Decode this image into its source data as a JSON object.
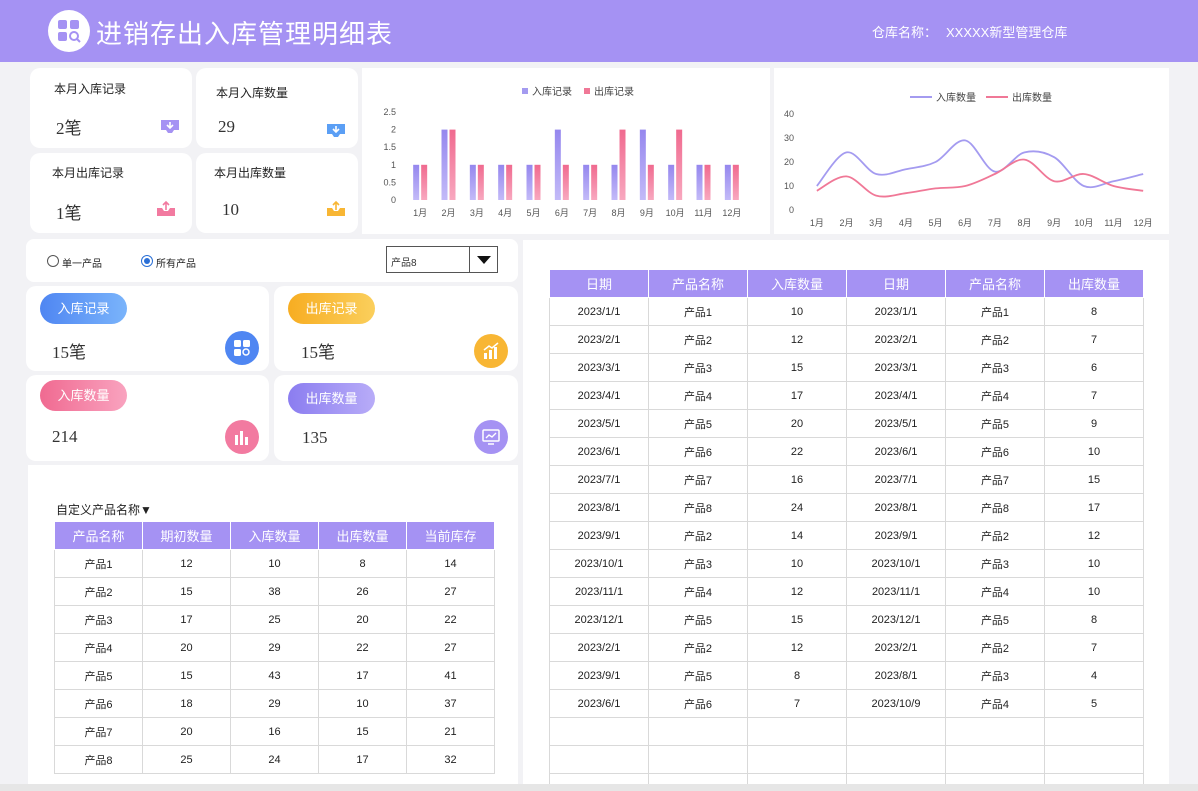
{
  "header": {
    "title": "进销存出入库管理明细表",
    "warehouse_label": "仓库名称：",
    "warehouse_value": "XXXXX新型管理仓库"
  },
  "kpis": [
    {
      "label": "本月入库记录",
      "value": "2笔",
      "icon": "inbox-in-icon"
    },
    {
      "label": "本月入库数量",
      "value": "29",
      "icon": "inbox-in-icon"
    },
    {
      "label": "本月出库记录",
      "value": "1笔",
      "icon": "outbox-icon"
    },
    {
      "label": "本月出库数量",
      "value": "10",
      "icon": "outbox-icon"
    }
  ],
  "filter": {
    "radio_single": "单一产品",
    "radio_all": "所有产品",
    "selected": "all",
    "dropdown_value": "产品8"
  },
  "stats": [
    {
      "label": "入库记录",
      "value": "15笔",
      "color": "#5b8ff5",
      "icon": "grid-search-icon"
    },
    {
      "label": "出库记录",
      "value": "15笔",
      "color": "#f8b634",
      "icon": "chart-growth-icon"
    },
    {
      "label": "入库数量",
      "value": "214",
      "color": "#f27aa0",
      "icon": "bar-chart-icon"
    },
    {
      "label": "出库数量",
      "value": "135",
      "color": "#a592f3",
      "icon": "monitor-icon"
    }
  ],
  "colors": {
    "accent": "#a592f3",
    "in": "#a49bf0",
    "out": "#f07897"
  },
  "chart_data": [
    {
      "type": "bar",
      "categories": [
        "1月",
        "2月",
        "3月",
        "4月",
        "5月",
        "6月",
        "7月",
        "8月",
        "9月",
        "10月",
        "11月",
        "12月"
      ],
      "series": [
        {
          "name": "入库记录",
          "values": [
            1,
            2,
            1,
            1,
            1,
            2,
            1,
            1,
            2,
            1,
            1,
            1
          ]
        },
        {
          "name": "出库记录",
          "values": [
            1,
            2,
            1,
            1,
            1,
            1,
            1,
            2,
            1,
            2,
            1,
            1
          ]
        }
      ],
      "yticks": [
        "0",
        "0.5",
        "1",
        "1.5",
        "2",
        "2.5"
      ],
      "ylim": [
        0,
        2.5
      ],
      "legend": "top-center"
    },
    {
      "type": "line",
      "categories": [
        "1月",
        "2月",
        "3月",
        "4月",
        "5月",
        "6月",
        "7月",
        "8月",
        "9月",
        "10月",
        "11月",
        "12月"
      ],
      "series": [
        {
          "name": "入库数量",
          "values": [
            10,
            24,
            15,
            17,
            20,
            29,
            16,
            24,
            22,
            10,
            12,
            15
          ]
        },
        {
          "name": "出库数量",
          "values": [
            8,
            14,
            6,
            7,
            9,
            10,
            15,
            21,
            12,
            15,
            10,
            8
          ]
        }
      ],
      "yticks": [
        "0",
        "10",
        "20",
        "30",
        "40"
      ],
      "ylim": [
        0,
        40
      ],
      "legend": "top-center"
    }
  ],
  "summary_table": {
    "title": "自定义产品名称▼",
    "headers": [
      "产品名称",
      "期初数量",
      "入库数量",
      "出库数量",
      "当前库存"
    ],
    "rows": [
      [
        "产品1",
        "12",
        "10",
        "8",
        "14"
      ],
      [
        "产品2",
        "15",
        "38",
        "26",
        "27"
      ],
      [
        "产品3",
        "17",
        "25",
        "20",
        "22"
      ],
      [
        "产品4",
        "20",
        "29",
        "22",
        "27"
      ],
      [
        "产品5",
        "15",
        "43",
        "17",
        "41"
      ],
      [
        "产品6",
        "18",
        "29",
        "10",
        "37"
      ],
      [
        "产品7",
        "20",
        "16",
        "15",
        "21"
      ],
      [
        "产品8",
        "25",
        "24",
        "17",
        "32"
      ]
    ]
  },
  "detail_table": {
    "headers": [
      "日期",
      "产品名称",
      "入库数量",
      "日期",
      "产品名称",
      "出库数量"
    ],
    "rows": [
      [
        "2023/1/1",
        "产品1",
        "10",
        "2023/1/1",
        "产品1",
        "8"
      ],
      [
        "2023/2/1",
        "产品2",
        "12",
        "2023/2/1",
        "产品2",
        "7"
      ],
      [
        "2023/3/1",
        "产品3",
        "15",
        "2023/3/1",
        "产品3",
        "6"
      ],
      [
        "2023/4/1",
        "产品4",
        "17",
        "2023/4/1",
        "产品4",
        "7"
      ],
      [
        "2023/5/1",
        "产品5",
        "20",
        "2023/5/1",
        "产品5",
        "9"
      ],
      [
        "2023/6/1",
        "产品6",
        "22",
        "2023/6/1",
        "产品6",
        "10"
      ],
      [
        "2023/7/1",
        "产品7",
        "16",
        "2023/7/1",
        "产品7",
        "15"
      ],
      [
        "2023/8/1",
        "产品8",
        "24",
        "2023/8/1",
        "产品8",
        "17"
      ],
      [
        "2023/9/1",
        "产品2",
        "14",
        "2023/9/1",
        "产品2",
        "12"
      ],
      [
        "2023/10/1",
        "产品3",
        "10",
        "2023/10/1",
        "产品3",
        "10"
      ],
      [
        "2023/11/1",
        "产品4",
        "12",
        "2023/11/1",
        "产品4",
        "10"
      ],
      [
        "2023/12/1",
        "产品5",
        "15",
        "2023/12/1",
        "产品5",
        "8"
      ],
      [
        "2023/2/1",
        "产品2",
        "12",
        "2023/2/1",
        "产品2",
        "7"
      ],
      [
        "2023/9/1",
        "产品5",
        "8",
        "2023/8/1",
        "产品3",
        "4"
      ],
      [
        "2023/6/1",
        "产品6",
        "7",
        "2023/10/9",
        "产品4",
        "5"
      ],
      [
        "",
        "",
        "",
        "",
        "",
        ""
      ],
      [
        "",
        "",
        "",
        "",
        "",
        ""
      ],
      [
        "",
        "",
        "",
        "",
        "",
        ""
      ]
    ]
  }
}
